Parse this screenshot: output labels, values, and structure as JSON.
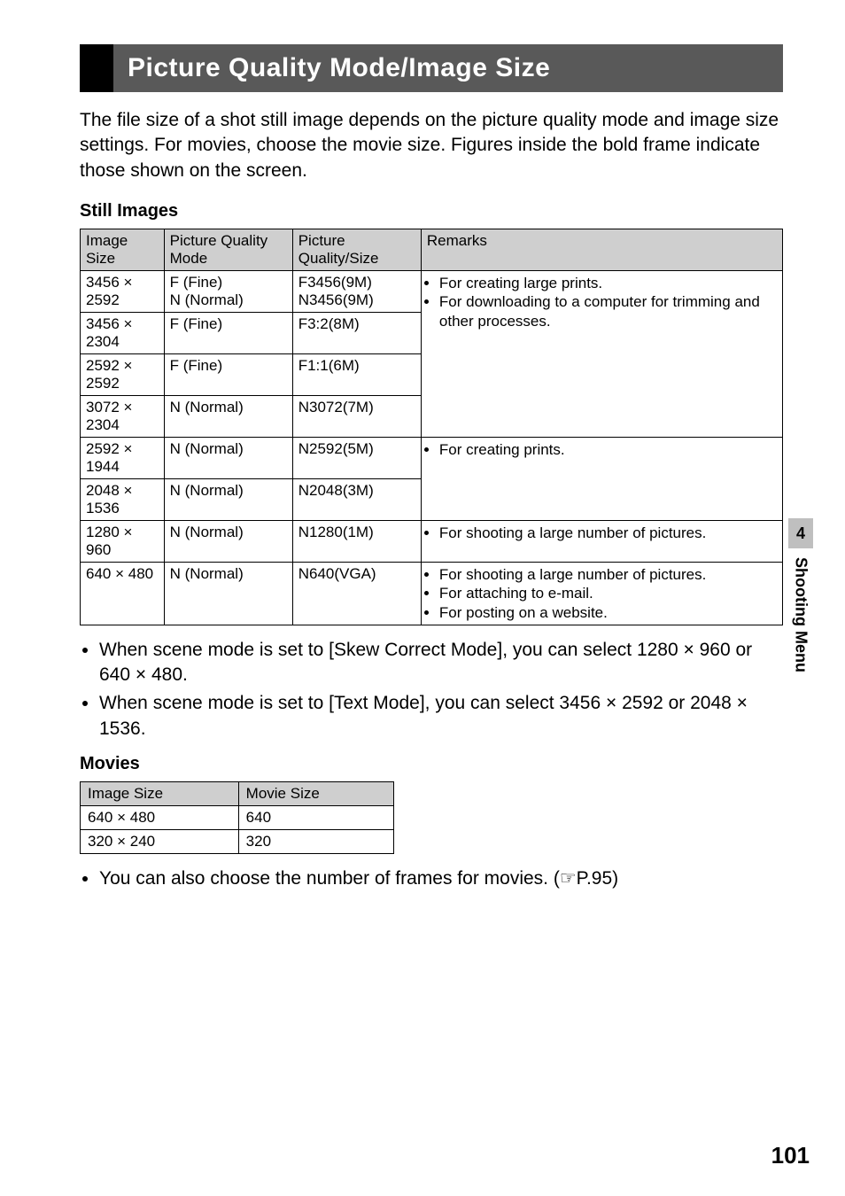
{
  "title": "Picture Quality Mode/Image Size",
  "intro": "The file size of a shot still image depends on the picture quality mode and image size settings. For movies, choose the movie size. Figures inside the bold frame indicate those shown on the screen.",
  "still": {
    "heading": "Still Images",
    "columns": {
      "c1": "Image Size",
      "c2": "Picture Quality Mode",
      "c3": "Picture Quality/Size",
      "c4": "Remarks"
    },
    "rows": {
      "r0": {
        "size": "3456 × 2592",
        "mode1": "F (Fine)",
        "mode2": "N (Normal)",
        "pq1": "F3456(9M)",
        "pq2": "N3456(9M)"
      },
      "r1": {
        "size": "3456 × 2304",
        "mode": "F (Fine)",
        "pq": "F3:2(8M)"
      },
      "r2": {
        "size": "2592 × 2592",
        "mode": "F (Fine)",
        "pq": "F1:1(6M)"
      },
      "r3": {
        "size": "3072 × 2304",
        "mode": "N (Normal)",
        "pq": "N3072(7M)"
      },
      "r4": {
        "size": "2592 × 1944",
        "mode": "N (Normal)",
        "pq": "N2592(5M)"
      },
      "r5": {
        "size": "2048 × 1536",
        "mode": "N (Normal)",
        "pq": "N2048(3M)"
      },
      "r6": {
        "size": "1280 × 960",
        "mode": "N (Normal)",
        "pq": "N1280(1M)"
      },
      "r7": {
        "size": "640 × 480",
        "mode": "N (Normal)",
        "pq": "N640(VGA)"
      }
    },
    "remarks": {
      "g1_l1": "For creating large prints.",
      "g1_l2": "For downloading to a computer for trimming and other processes.",
      "g2_l1": "For creating prints.",
      "g3_l1": "For shooting a large number of pictures.",
      "g4_l1": "For shooting a large number of pictures.",
      "g4_l2": "For attaching to e-mail.",
      "g4_l3": "For posting on a website."
    }
  },
  "bullets_after_still": {
    "b1": "When scene mode is set to [Skew Correct Mode], you can select 1280 × 960 or 640 × 480.",
    "b2": "When scene mode is set to [Text Mode], you can select 3456 × 2592 or 2048 × 1536."
  },
  "movies": {
    "heading": "Movies",
    "columns": {
      "c1": "Image Size",
      "c2": "Movie Size"
    },
    "rows": {
      "r0": {
        "size": "640 × 480",
        "ms": "640"
      },
      "r1": {
        "size": "320 × 240",
        "ms": "320"
      }
    }
  },
  "bullet_after_movies_prefix": "You can also choose the number of frames for movies. (",
  "bullet_after_movies_link": "P.95",
  "bullet_after_movies_suffix": ")",
  "side": {
    "num": "4",
    "label": "Shooting Menu"
  },
  "page_number": "101"
}
